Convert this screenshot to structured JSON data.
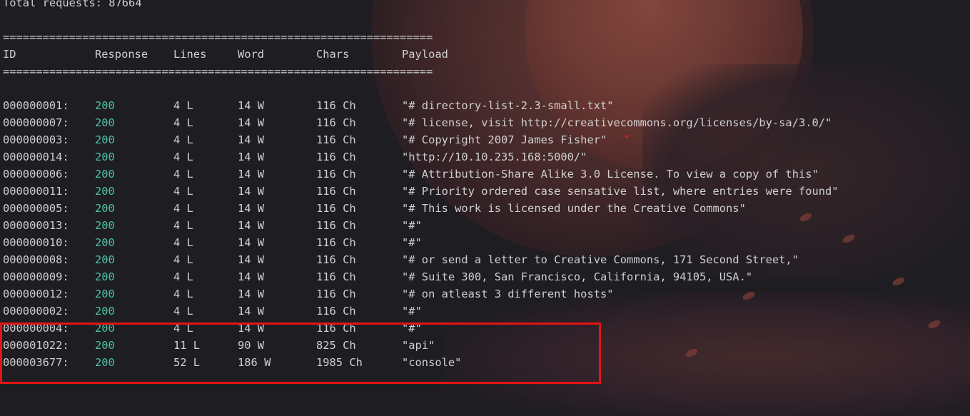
{
  "summary": {
    "total_requests": "Total requests: 87664"
  },
  "separator": "=================================================================",
  "headers": {
    "id": "ID",
    "response": "Response",
    "lines": "Lines",
    "word": "Word",
    "chars": "Chars",
    "payload": "Payload"
  },
  "rows": [
    {
      "id": "000000001:",
      "response": "200",
      "lines": "4 L",
      "word": "14 W",
      "chars": "116 Ch",
      "payload": "\"# directory-list-2.3-small.txt\""
    },
    {
      "id": "000000007:",
      "response": "200",
      "lines": "4 L",
      "word": "14 W",
      "chars": "116 Ch",
      "payload": "\"# license, visit http://creativecommons.org/licenses/by-sa/3.0/\""
    },
    {
      "id": "000000003:",
      "response": "200",
      "lines": "4 L",
      "word": "14 W",
      "chars": "116 Ch",
      "payload": "\"# Copyright 2007 James Fisher\""
    },
    {
      "id": "000000014:",
      "response": "200",
      "lines": "4 L",
      "word": "14 W",
      "chars": "116 Ch",
      "payload": "\"http://10.10.235.168:5000/\""
    },
    {
      "id": "000000006:",
      "response": "200",
      "lines": "4 L",
      "word": "14 W",
      "chars": "116 Ch",
      "payload": "\"# Attribution-Share Alike 3.0 License. To view a copy of this\""
    },
    {
      "id": "000000011:",
      "response": "200",
      "lines": "4 L",
      "word": "14 W",
      "chars": "116 Ch",
      "payload": "\"# Priority ordered case sensative list, where entries were found\""
    },
    {
      "id": "000000005:",
      "response": "200",
      "lines": "4 L",
      "word": "14 W",
      "chars": "116 Ch",
      "payload": "\"# This work is licensed under the Creative Commons\""
    },
    {
      "id": "000000013:",
      "response": "200",
      "lines": "4 L",
      "word": "14 W",
      "chars": "116 Ch",
      "payload": "\"#\""
    },
    {
      "id": "000000010:",
      "response": "200",
      "lines": "4 L",
      "word": "14 W",
      "chars": "116 Ch",
      "payload": "\"#\""
    },
    {
      "id": "000000008:",
      "response": "200",
      "lines": "4 L",
      "word": "14 W",
      "chars": "116 Ch",
      "payload": "\"# or send a letter to Creative Commons, 171 Second Street,\""
    },
    {
      "id": "000000009:",
      "response": "200",
      "lines": "4 L",
      "word": "14 W",
      "chars": "116 Ch",
      "payload": "\"# Suite 300, San Francisco, California, 94105, USA.\""
    },
    {
      "id": "000000012:",
      "response": "200",
      "lines": "4 L",
      "word": "14 W",
      "chars": "116 Ch",
      "payload": "\"# on atleast 3 different hosts\""
    },
    {
      "id": "000000002:",
      "response": "200",
      "lines": "4 L",
      "word": "14 W",
      "chars": "116 Ch",
      "payload": "\"#\""
    },
    {
      "id": "000000004:",
      "response": "200",
      "lines": "4 L",
      "word": "14 W",
      "chars": "116 Ch",
      "payload": "\"#\""
    },
    {
      "id": "000001022:",
      "response": "200",
      "lines": "11 L",
      "word": "90 W",
      "chars": "825 Ch",
      "payload": "\"api\""
    },
    {
      "id": "000003677:",
      "response": "200",
      "lines": "52 L",
      "word": "186 W",
      "chars": "1985 Ch",
      "payload": "\"console\""
    }
  ],
  "colors": {
    "background": "#1d1d22",
    "text": "#d0d0d0",
    "status_ok": "#4fc1a5",
    "highlight": "#e41414"
  }
}
